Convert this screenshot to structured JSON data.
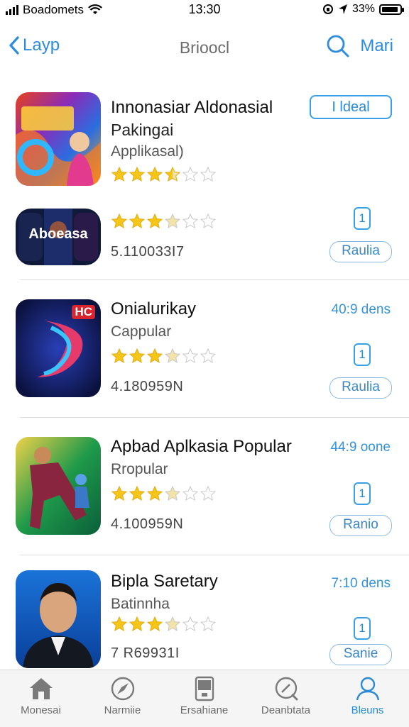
{
  "status_bar": {
    "carrier": "Boadomets",
    "time": "13:30",
    "battery": "33%",
    "battery_level": 0.9
  },
  "nav": {
    "back_label": "Layp",
    "title": "Brioocl",
    "right_label": "Mari",
    "search_icon": "search-icon"
  },
  "apps": [
    {
      "name": "Innonasiar Aldonasial",
      "subtitle": "Pakingai",
      "category": "Applikasal)",
      "rating": 3.5,
      "action": "I ldeal"
    },
    {
      "icon_text": "Aboeasa",
      "rating": 3,
      "meta": "5.110033I7",
      "count": "1",
      "action": "Raulia"
    },
    {
      "name": "Onialurikay",
      "subtitle": "Cappular",
      "rating": 3,
      "meta": "4.180959N",
      "right_text": "40:9 dens",
      "count": "1",
      "action": "Raulia",
      "badge": "HC"
    },
    {
      "name": "Apbad Aplkasia Popular",
      "subtitle": "Rropular",
      "rating": 3,
      "meta": "4.100959N",
      "right_text": "44:9 oone",
      "count": "1",
      "action": "Ranio"
    },
    {
      "name": "Bipla Saretary",
      "subtitle": "Batinnha",
      "rating": 3,
      "meta": "7 R69931I",
      "right_text": "7:10 dens",
      "count": "1",
      "action": "Sanie"
    }
  ],
  "tabs": [
    {
      "label": "Monesai",
      "icon": "home-icon"
    },
    {
      "label": "Narmiie",
      "icon": "compass-icon"
    },
    {
      "label": "Ersahiane",
      "icon": "device-icon"
    },
    {
      "label": "Deanbtata",
      "icon": "search-globe-icon"
    },
    {
      "label": "Bleuns",
      "icon": "person-icon",
      "active": true
    }
  ],
  "colors": {
    "accent": "#2d8cde",
    "star": "#f5c518",
    "star_empty": "#d9d9d9"
  }
}
